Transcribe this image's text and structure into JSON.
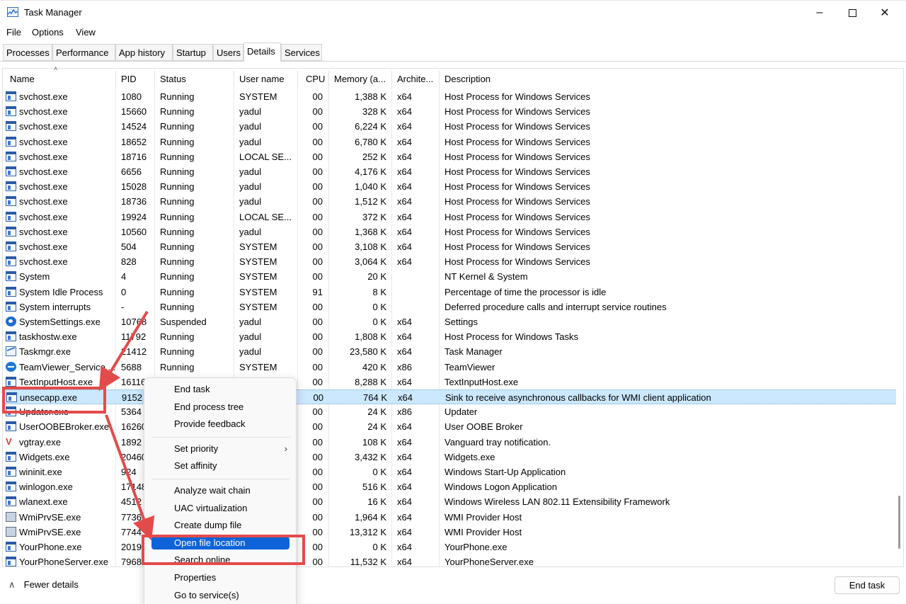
{
  "window": {
    "title": "Task Manager",
    "min_icon": "minimize-icon",
    "max_icon": "maximize-icon",
    "close_icon": "close-icon"
  },
  "menu": [
    "File",
    "Options",
    "View"
  ],
  "tabs": [
    "Processes",
    "Performance",
    "App history",
    "Startup",
    "Users",
    "Details",
    "Services"
  ],
  "active_tab": "Details",
  "columns": [
    "Name",
    "PID",
    "Status",
    "User name",
    "CPU",
    "Memory (a...",
    "Archite...",
    "Description"
  ],
  "rows": [
    {
      "icon": "window",
      "name": "svchost.exe",
      "pid": "1080",
      "status": "Running",
      "user": "SYSTEM",
      "cpu": "00",
      "mem": "1,388 K",
      "arch": "x64",
      "desc": "Host Process for Windows Services"
    },
    {
      "icon": "window",
      "name": "svchost.exe",
      "pid": "15660",
      "status": "Running",
      "user": "yadul",
      "cpu": "00",
      "mem": "328 K",
      "arch": "x64",
      "desc": "Host Process for Windows Services"
    },
    {
      "icon": "window",
      "name": "svchost.exe",
      "pid": "14524",
      "status": "Running",
      "user": "yadul",
      "cpu": "00",
      "mem": "6,224 K",
      "arch": "x64",
      "desc": "Host Process for Windows Services"
    },
    {
      "icon": "window",
      "name": "svchost.exe",
      "pid": "18652",
      "status": "Running",
      "user": "yadul",
      "cpu": "00",
      "mem": "6,780 K",
      "arch": "x64",
      "desc": "Host Process for Windows Services"
    },
    {
      "icon": "window",
      "name": "svchost.exe",
      "pid": "18716",
      "status": "Running",
      "user": "LOCAL SE...",
      "cpu": "00",
      "mem": "252 K",
      "arch": "x64",
      "desc": "Host Process for Windows Services"
    },
    {
      "icon": "window",
      "name": "svchost.exe",
      "pid": "6656",
      "status": "Running",
      "user": "yadul",
      "cpu": "00",
      "mem": "4,176 K",
      "arch": "x64",
      "desc": "Host Process for Windows Services"
    },
    {
      "icon": "window",
      "name": "svchost.exe",
      "pid": "15028",
      "status": "Running",
      "user": "yadul",
      "cpu": "00",
      "mem": "1,040 K",
      "arch": "x64",
      "desc": "Host Process for Windows Services"
    },
    {
      "icon": "window",
      "name": "svchost.exe",
      "pid": "18736",
      "status": "Running",
      "user": "yadul",
      "cpu": "00",
      "mem": "1,512 K",
      "arch": "x64",
      "desc": "Host Process for Windows Services"
    },
    {
      "icon": "window",
      "name": "svchost.exe",
      "pid": "19924",
      "status": "Running",
      "user": "LOCAL SE...",
      "cpu": "00",
      "mem": "372 K",
      "arch": "x64",
      "desc": "Host Process for Windows Services"
    },
    {
      "icon": "window",
      "name": "svchost.exe",
      "pid": "10560",
      "status": "Running",
      "user": "yadul",
      "cpu": "00",
      "mem": "1,368 K",
      "arch": "x64",
      "desc": "Host Process for Windows Services"
    },
    {
      "icon": "window",
      "name": "svchost.exe",
      "pid": "504",
      "status": "Running",
      "user": "SYSTEM",
      "cpu": "00",
      "mem": "3,108 K",
      "arch": "x64",
      "desc": "Host Process for Windows Services"
    },
    {
      "icon": "window",
      "name": "svchost.exe",
      "pid": "828",
      "status": "Running",
      "user": "SYSTEM",
      "cpu": "00",
      "mem": "3,064 K",
      "arch": "x64",
      "desc": "Host Process for Windows Services"
    },
    {
      "icon": "window",
      "name": "System",
      "pid": "4",
      "status": "Running",
      "user": "SYSTEM",
      "cpu": "00",
      "mem": "20 K",
      "arch": "",
      "desc": "NT Kernel & System"
    },
    {
      "icon": "window",
      "name": "System Idle Process",
      "pid": "0",
      "status": "Running",
      "user": "SYSTEM",
      "cpu": "91",
      "mem": "8 K",
      "arch": "",
      "desc": "Percentage of time the processor is idle"
    },
    {
      "icon": "window",
      "name": "System interrupts",
      "pid": "-",
      "status": "Running",
      "user": "SYSTEM",
      "cpu": "00",
      "mem": "0 K",
      "arch": "",
      "desc": "Deferred procedure calls and interrupt service routines"
    },
    {
      "icon": "gear",
      "name": "SystemSettings.exe",
      "pid": "10768",
      "status": "Suspended",
      "user": "yadul",
      "cpu": "00",
      "mem": "0 K",
      "arch": "x64",
      "desc": "Settings"
    },
    {
      "icon": "window",
      "name": "taskhostw.exe",
      "pid": "11792",
      "status": "Running",
      "user": "yadul",
      "cpu": "00",
      "mem": "1,808 K",
      "arch": "x64",
      "desc": "Host Process for Windows Tasks"
    },
    {
      "icon": "chart",
      "name": "Taskmgr.exe",
      "pid": "21412",
      "status": "Running",
      "user": "yadul",
      "cpu": "00",
      "mem": "23,580 K",
      "arch": "x64",
      "desc": "Task Manager"
    },
    {
      "icon": "tv",
      "name": "TeamViewer_Service....",
      "pid": "5688",
      "status": "Running",
      "user": "SYSTEM",
      "cpu": "00",
      "mem": "420 K",
      "arch": "x86",
      "desc": "TeamViewer"
    },
    {
      "icon": "window",
      "name": "TextInputHost.exe",
      "pid": "16116",
      "status": "",
      "user": "",
      "cpu": "00",
      "mem": "8,288 K",
      "arch": "x64",
      "desc": "TextInputHost.exe"
    },
    {
      "icon": "window",
      "name": "unsecapp.exe",
      "pid": "9152",
      "status": "",
      "user": "",
      "cpu": "00",
      "mem": "764 K",
      "arch": "x64",
      "desc": "Sink to receive asynchronous callbacks for WMI client application",
      "selected": true
    },
    {
      "icon": "window",
      "name": "Updater.exe",
      "pid": "5364",
      "status": "",
      "user": "",
      "cpu": "00",
      "mem": "24 K",
      "arch": "x86",
      "desc": "Updater"
    },
    {
      "icon": "window",
      "name": "UserOOBEBroker.exe",
      "pid": "16260",
      "status": "",
      "user": "",
      "cpu": "00",
      "mem": "24 K",
      "arch": "x64",
      "desc": "User OOBE Broker"
    },
    {
      "icon": "v",
      "name": "vgtray.exe",
      "pid": "1892",
      "status": "",
      "user": "",
      "cpu": "00",
      "mem": "108 K",
      "arch": "x64",
      "desc": "Vanguard tray notification."
    },
    {
      "icon": "window",
      "name": "Widgets.exe",
      "pid": "20460",
      "status": "",
      "user": "",
      "cpu": "00",
      "mem": "3,432 K",
      "arch": "x64",
      "desc": "Widgets.exe"
    },
    {
      "icon": "window",
      "name": "wininit.exe",
      "pid": "924",
      "status": "",
      "user": "",
      "cpu": "00",
      "mem": "0 K",
      "arch": "x64",
      "desc": "Windows Start-Up Application"
    },
    {
      "icon": "window",
      "name": "winlogon.exe",
      "pid": "17148",
      "status": "",
      "user": "",
      "cpu": "00",
      "mem": "516 K",
      "arch": "x64",
      "desc": "Windows Logon Application"
    },
    {
      "icon": "window",
      "name": "wlanext.exe",
      "pid": "4512",
      "status": "",
      "user": "",
      "cpu": "00",
      "mem": "16 K",
      "arch": "x64",
      "desc": "Windows Wireless LAN 802.11 Extensibility Framework"
    },
    {
      "icon": "wmi",
      "name": "WmiPrvSE.exe",
      "pid": "7736",
      "status": "",
      "user": "",
      "cpu": "00",
      "mem": "1,964 K",
      "arch": "x64",
      "desc": "WMI Provider Host"
    },
    {
      "icon": "wmi",
      "name": "WmiPrvSE.exe",
      "pid": "7744",
      "status": "",
      "user": "",
      "cpu": "00",
      "mem": "13,312 K",
      "arch": "x64",
      "desc": "WMI Provider Host"
    },
    {
      "icon": "window",
      "name": "YourPhone.exe",
      "pid": "20193",
      "status": "",
      "user": "",
      "cpu": "00",
      "mem": "0 K",
      "arch": "x64",
      "desc": "YourPhone.exe"
    },
    {
      "icon": "window",
      "name": "YourPhoneServer.exe",
      "pid": "7968",
      "status": "",
      "user": "",
      "cpu": "00",
      "mem": "11,532 K",
      "arch": "x64",
      "desc": "YourPhoneServer.exe"
    }
  ],
  "context_menu": {
    "items": [
      {
        "label": "End task"
      },
      {
        "label": "End process tree"
      },
      {
        "label": "Provide feedback",
        "sep_after": true
      },
      {
        "label": "Set priority",
        "submenu": true
      },
      {
        "label": "Set affinity",
        "sep_after": true
      },
      {
        "label": "Analyze wait chain"
      },
      {
        "label": "UAC virtualization"
      },
      {
        "label": "Create dump file"
      },
      {
        "label": "Open file location",
        "highlighted": true
      },
      {
        "label": "Search online"
      },
      {
        "label": "Properties"
      },
      {
        "label": "Go to service(s)"
      }
    ],
    "submenu_icon": "chevron-right-icon"
  },
  "footer": {
    "fewer_details": "Fewer details",
    "fewer_icon": "chevron-up-icon",
    "end_task": "End task"
  },
  "colors": {
    "selection": "#cce8ff",
    "menu_highlight": "#0e63d8",
    "annotation": "#e34b4b"
  }
}
